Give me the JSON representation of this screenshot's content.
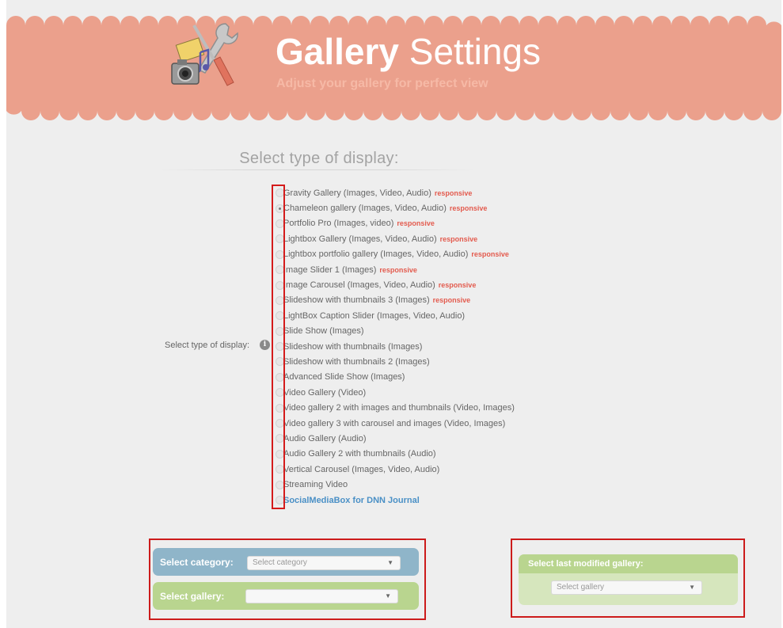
{
  "header": {
    "title_bold": "Gallery",
    "title_light": "Settings",
    "subtitle": "Adjust your gallery for perfect view",
    "icon": "camera-tools-icon",
    "colors": {
      "banner": "#eba08c",
      "text": "#ffffff"
    }
  },
  "display_section": {
    "heading": "Select type of display:",
    "field_label": "Select type of display:",
    "info_icon_glyph": "i",
    "selected_index": 1,
    "options": [
      {
        "label": "Gravity Gallery (Images, Video, Audio)",
        "badge": "responsive"
      },
      {
        "label": "Chameleon gallery (Images, Video, Audio)",
        "badge": "responsive"
      },
      {
        "label": "Portfolio Pro (Images, video)",
        "badge": "responsive"
      },
      {
        "label": "Lightbox Gallery (Images, Video, Audio)",
        "badge": "responsive"
      },
      {
        "label": "Lightbox portfolio gallery (Images, Video, Audio)",
        "badge": "responsive"
      },
      {
        "label": "Image Slider 1 (Images)",
        "badge": "responsive"
      },
      {
        "label": "Image Carousel (Images, Video, Audio)",
        "badge": "responsive"
      },
      {
        "label": "Slideshow with thumbnails 3 (Images)",
        "badge": "responsive"
      },
      {
        "label": "LightBox Caption Slider (Images, Video, Audio)",
        "badge": ""
      },
      {
        "label": "Slide Show (Images)",
        "badge": ""
      },
      {
        "label": "Slideshow with thumbnails (Images)",
        "badge": ""
      },
      {
        "label": "Slideshow with thumbnails 2 (Images)",
        "badge": ""
      },
      {
        "label": "Advanced Slide Show (Images)",
        "badge": ""
      },
      {
        "label": "Video Gallery (Video)",
        "badge": ""
      },
      {
        "label": "Video gallery 2 with images and thumbnails (Video, Images)",
        "badge": ""
      },
      {
        "label": "Video gallery 3 with carousel and images (Video, Images)",
        "badge": ""
      },
      {
        "label": "Audio Gallery (Audio)",
        "badge": ""
      },
      {
        "label": "Audio Gallery 2 with thumbnails (Audio)",
        "badge": ""
      },
      {
        "label": "Vertical Carousel (Images, Video, Audio)",
        "badge": ""
      },
      {
        "label": "Streaming Video",
        "badge": ""
      },
      {
        "label": "SocialMediaBox for DNN Journal",
        "badge": "",
        "link": true
      }
    ]
  },
  "category_panel": {
    "category_label": "Select category:",
    "category_value": "Select category",
    "gallery_label": "Select gallery:",
    "gallery_value": "",
    "colors": {
      "category_row": "#8fb5c9",
      "gallery_row": "#b9d58f"
    }
  },
  "last_modified_panel": {
    "label": "Select last modified gallery:",
    "value": "Select gallery",
    "colors": {
      "header": "#b9d58f",
      "body": "#d6e6bd"
    }
  },
  "dropdown_arrow": "▼",
  "annotation_color": "#cc1b1b"
}
